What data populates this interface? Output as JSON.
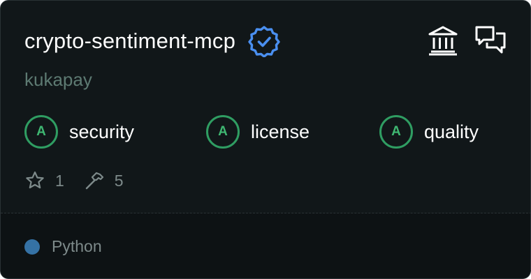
{
  "card": {
    "title": "crypto-sentiment-mcp",
    "owner": "kukapay",
    "verified_icon": "verified-badge-icon",
    "actions": [
      {
        "icon": "bank-icon"
      },
      {
        "icon": "chat-bubbles-icon"
      }
    ],
    "scores": [
      {
        "grade": "A",
        "label": "security"
      },
      {
        "grade": "A",
        "label": "license"
      },
      {
        "grade": "A",
        "label": "quality"
      }
    ],
    "stats": {
      "stars": "1",
      "tools": "5"
    },
    "language": {
      "name": "Python",
      "color": "#3572a5"
    },
    "colors": {
      "background": "#111719",
      "accent_verified": "#4a8ff0",
      "grade_green": "#2f9d62"
    }
  }
}
